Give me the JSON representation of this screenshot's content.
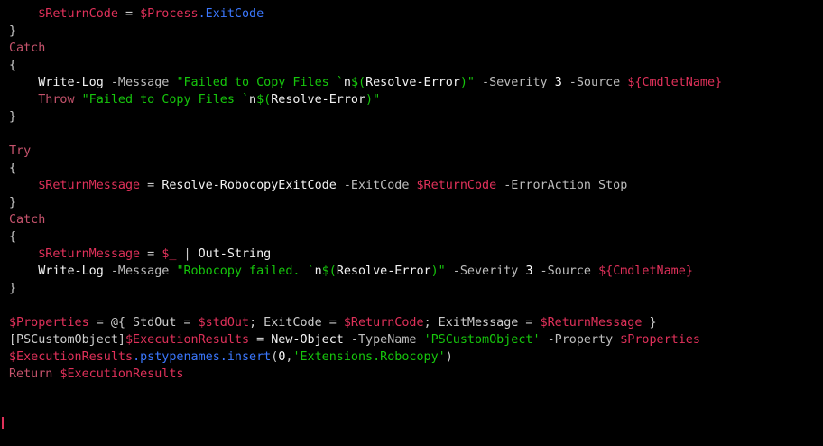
{
  "lines": [
    [
      {
        "t": "    ",
        "c": "plain"
      },
      {
        "t": "$ReturnCode",
        "c": "var"
      },
      {
        "t": " = ",
        "c": "plain"
      },
      {
        "t": "$Process",
        "c": "var"
      },
      {
        "t": ".ExitCode",
        "c": "prop"
      }
    ],
    [
      {
        "t": "}",
        "c": "plain"
      }
    ],
    [
      {
        "t": "Catch",
        "c": "kw"
      }
    ],
    [
      {
        "t": "{",
        "c": "plain"
      }
    ],
    [
      {
        "t": "    ",
        "c": "plain"
      },
      {
        "t": "Write-Log",
        "c": "cmd"
      },
      {
        "t": " -Message ",
        "c": "param"
      },
      {
        "t": "\"Failed to Copy Files `",
        "c": "str"
      },
      {
        "t": "n",
        "c": "cmd"
      },
      {
        "t": "$(",
        "c": "str"
      },
      {
        "t": "Resolve-Error",
        "c": "cmd"
      },
      {
        "t": ")\"",
        "c": "str"
      },
      {
        "t": " -Severity ",
        "c": "param"
      },
      {
        "t": "3",
        "c": "num"
      },
      {
        "t": " -Source ",
        "c": "param"
      },
      {
        "t": "${",
        "c": "var"
      },
      {
        "t": "CmdletName",
        "c": "var"
      },
      {
        "t": "}",
        "c": "var"
      }
    ],
    [
      {
        "t": "    ",
        "c": "plain"
      },
      {
        "t": "Throw",
        "c": "kw"
      },
      {
        "t": " \"Failed to Copy Files `",
        "c": "str"
      },
      {
        "t": "n",
        "c": "cmd"
      },
      {
        "t": "$(",
        "c": "str"
      },
      {
        "t": "Resolve-Error",
        "c": "cmd"
      },
      {
        "t": ")\"",
        "c": "str"
      }
    ],
    [
      {
        "t": "}",
        "c": "plain"
      }
    ],
    [],
    [
      {
        "t": "Try",
        "c": "kw"
      }
    ],
    [
      {
        "t": "{",
        "c": "plain"
      }
    ],
    [
      {
        "t": "    ",
        "c": "plain"
      },
      {
        "t": "$ReturnMessage",
        "c": "var"
      },
      {
        "t": " = ",
        "c": "plain"
      },
      {
        "t": "Resolve-RobocopyExitCode",
        "c": "cmd"
      },
      {
        "t": " -ExitCode ",
        "c": "param"
      },
      {
        "t": "$ReturnCode",
        "c": "var"
      },
      {
        "t": " -ErrorAction Stop",
        "c": "param"
      }
    ],
    [
      {
        "t": "}",
        "c": "plain"
      }
    ],
    [
      {
        "t": "Catch",
        "c": "kw"
      }
    ],
    [
      {
        "t": "{",
        "c": "plain"
      }
    ],
    [
      {
        "t": "    ",
        "c": "plain"
      },
      {
        "t": "$ReturnMessage",
        "c": "var"
      },
      {
        "t": " = ",
        "c": "plain"
      },
      {
        "t": "$_",
        "c": "var"
      },
      {
        "t": " | ",
        "c": "plain"
      },
      {
        "t": "Out-String",
        "c": "cmd"
      }
    ],
    [
      {
        "t": "    ",
        "c": "plain"
      },
      {
        "t": "Write-Log",
        "c": "cmd"
      },
      {
        "t": " -Message ",
        "c": "param"
      },
      {
        "t": "\"Robocopy failed. `",
        "c": "str"
      },
      {
        "t": "n",
        "c": "cmd"
      },
      {
        "t": "$(",
        "c": "str"
      },
      {
        "t": "Resolve-Error",
        "c": "cmd"
      },
      {
        "t": ")\"",
        "c": "str"
      },
      {
        "t": " -Severity ",
        "c": "param"
      },
      {
        "t": "3",
        "c": "num"
      },
      {
        "t": " -Source ",
        "c": "param"
      },
      {
        "t": "${",
        "c": "var"
      },
      {
        "t": "CmdletName",
        "c": "var"
      },
      {
        "t": "}",
        "c": "var"
      }
    ],
    [
      {
        "t": "}",
        "c": "plain"
      }
    ],
    [],
    [
      {
        "t": "$Properties",
        "c": "var"
      },
      {
        "t": " = @{ StdOut = ",
        "c": "plain"
      },
      {
        "t": "$stdOut",
        "c": "var"
      },
      {
        "t": "; ExitCode = ",
        "c": "plain"
      },
      {
        "t": "$ReturnCode",
        "c": "var"
      },
      {
        "t": "; ExitMessage = ",
        "c": "plain"
      },
      {
        "t": "$ReturnMessage",
        "c": "var"
      },
      {
        "t": " }",
        "c": "plain"
      }
    ],
    [
      {
        "t": "[PSCustomObject]",
        "c": "plain"
      },
      {
        "t": "$ExecutionResults",
        "c": "var"
      },
      {
        "t": " = ",
        "c": "plain"
      },
      {
        "t": "New-Object",
        "c": "cmd"
      },
      {
        "t": " -TypeName ",
        "c": "param"
      },
      {
        "t": "'PSCustomObject'",
        "c": "str"
      },
      {
        "t": " -Property ",
        "c": "param"
      },
      {
        "t": "$Properties",
        "c": "var"
      }
    ],
    [
      {
        "t": "$ExecutionResults",
        "c": "var"
      },
      {
        "t": ".pstypenames.insert",
        "c": "prop"
      },
      {
        "t": "(",
        "c": "plain"
      },
      {
        "t": "0",
        "c": "num"
      },
      {
        "t": ",",
        "c": "plain"
      },
      {
        "t": "'Extensions.Robocopy'",
        "c": "str"
      },
      {
        "t": ")",
        "c": "plain"
      }
    ],
    [
      {
        "t": "Return",
        "c": "kw"
      },
      {
        "t": " ",
        "c": "plain"
      },
      {
        "t": "$ExecutionResults",
        "c": "var"
      }
    ]
  ],
  "colors": {
    "background": "#000000",
    "plain": "#cccccc",
    "variable": "#e0315a",
    "keyword": "#c5536c",
    "command": "#f2f2f2",
    "parameter": "#bdbdbd",
    "string": "#16c60c",
    "number": "#ffffff",
    "member": "#3b78ff"
  }
}
